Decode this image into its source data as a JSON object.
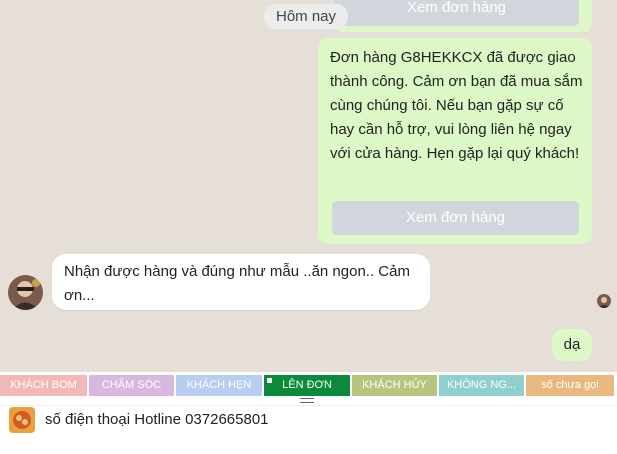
{
  "chat": {
    "date_divider": "Hôm nay",
    "top_button_label": "Xem đơn hàng",
    "outgoing_message": {
      "text": "Đơn hàng G8HEKKCX đã được giao thành công. Cảm ơn bạn đã mua sắm cùng chúng tôi. Nếu bạn gặp sự cố hay cần hỗ trợ, vui lòng liên hệ ngay với cửa hàng. Hẹn gặp lại quý khách!",
      "button_label": "Xem đơn hàng"
    },
    "incoming_message": {
      "text": "Nhận được hàng và đúng như mẫu ..ăn ngon.. Cảm ơn..."
    },
    "reply_message": "dạ"
  },
  "tags": [
    {
      "label": "KHÁCH BOM",
      "color": "#f2b8b8"
    },
    {
      "label": "CHĂM SÓC",
      "color": "#d9b8e0"
    },
    {
      "label": "KHÁCH HẸN",
      "color": "#b8cdf2"
    },
    {
      "label": "LÊN ĐƠN",
      "color": "#0b8a3a"
    },
    {
      "label": "KHÁCH HỦY",
      "color": "#b9c57f"
    },
    {
      "label": "KHÔNG NG...",
      "color": "#8fcfcf"
    },
    {
      "label": "số chưa gọi",
      "color": "#e8b87f"
    }
  ],
  "composer": {
    "hotline_text": "số điện thoại Hotline 0372665801"
  }
}
